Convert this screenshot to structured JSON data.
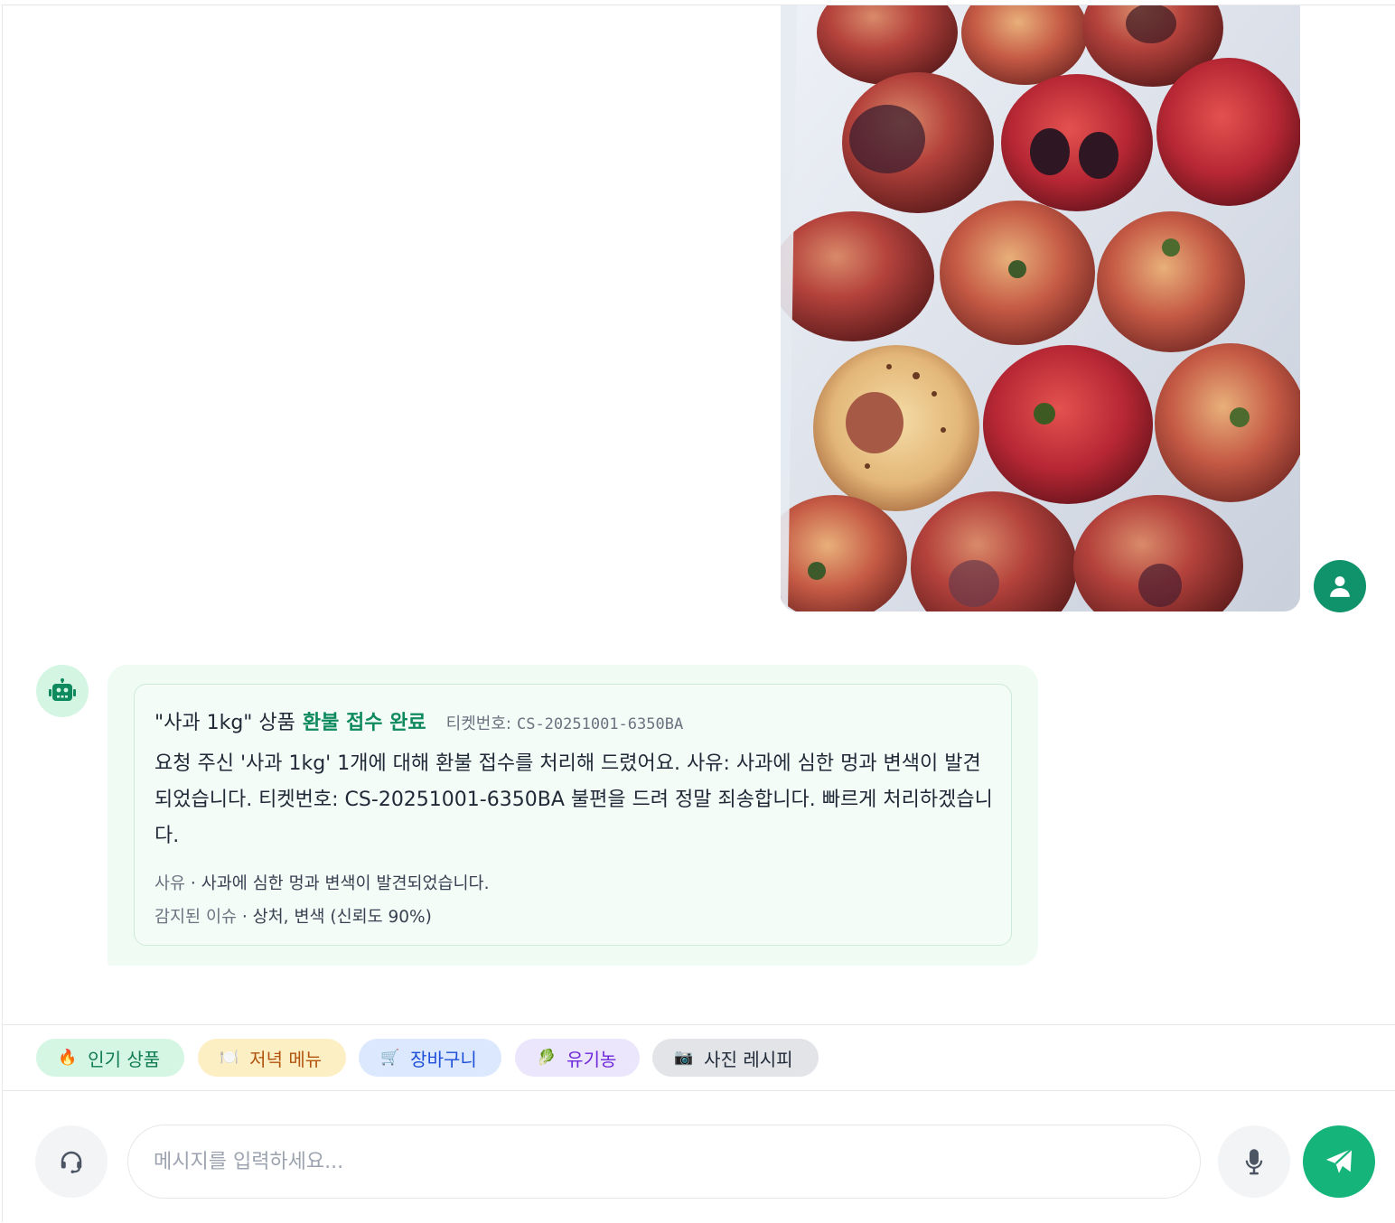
{
  "user_message": {
    "photo_alt": "",
    "avatar_icon": "user-icon"
  },
  "bot_message": {
    "avatar_icon": "robot-icon",
    "card": {
      "product": "\"사과 1kg\" 상품",
      "status": "환불 접수 완료",
      "ticket_label": "티켓번호:",
      "ticket_no": "CS-20251001-6350BA",
      "body": "요청 주신 '사과 1kg' 1개에 대해 환불 접수를 처리해 드렸어요. 사유: 사과에 심한 멍과 변색이 발견되었습니다. 티켓번호: CS-20251001-6350BA 불편을 드려 정말 죄송합니다. 빠르게 처리하겠습니다.",
      "reason_label": "사유",
      "reason_value": "사과에 심한 멍과 변색이 발견되었습니다.",
      "issues_label": "감지된 이슈",
      "issues_value": "상처, 변색 (신뢰도 90%)"
    }
  },
  "quick_chips": [
    {
      "icon": "🔥",
      "label": "인기 상품"
    },
    {
      "icon": "🍽️",
      "label": "저녁 메뉴"
    },
    {
      "icon": "🛒",
      "label": "장바구니"
    },
    {
      "icon": "🥬",
      "label": "유기농"
    },
    {
      "icon": "📷",
      "label": "사진 레시피"
    }
  ],
  "composer": {
    "placeholder": "메시지를 입력하세요...",
    "value": ""
  },
  "colors": {
    "brand_green": "#10936a",
    "send_green": "#14b47b",
    "bot_bubble": "#effbf3"
  }
}
